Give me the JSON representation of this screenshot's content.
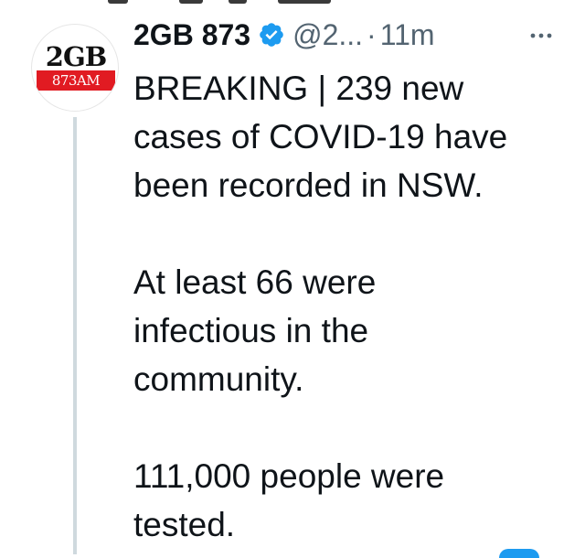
{
  "tweet": {
    "avatar": {
      "logo_top": "2GB",
      "logo_bottom": "873AM"
    },
    "author": {
      "name": "2GB 873",
      "verified": true,
      "handle": "@2...",
      "separator": "·",
      "time": "11m"
    },
    "body": {
      "line1": "BREAKING | 239 new",
      "line2": "cases of COVID-19 have",
      "line3": "been recorded in NSW.",
      "line4": "At least 66 were",
      "line5": "infectious in the",
      "line6": "community.",
      "line7": "111,000 people were",
      "line8": "tested."
    },
    "icons": {
      "verified": "verified-badge-icon",
      "more": "more-options-icon"
    }
  },
  "colors": {
    "verified_blue": "#1d9bf0",
    "secondary_text": "#536471",
    "primary_text": "#0f1419",
    "thread_line": "#cfd9de",
    "logo_red": "#e11b22"
  }
}
